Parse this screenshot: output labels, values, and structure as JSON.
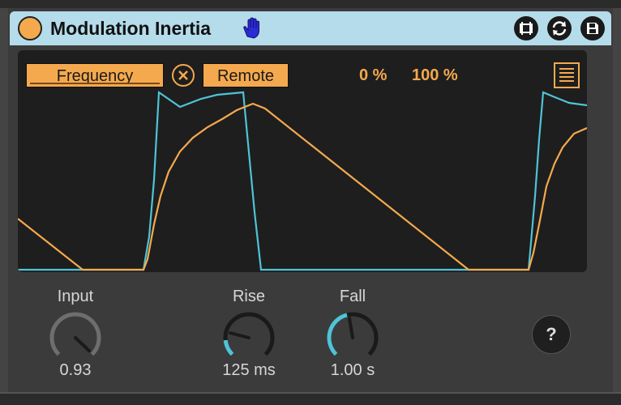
{
  "device": {
    "title": "Modulation Inertia",
    "accent_color": "#f5a94e",
    "title_bar_color": "#b5dcea",
    "trace_color_input": "#4fc3d8",
    "trace_color_output": "#f5a94e"
  },
  "header_icons": [
    "hand-icon",
    "resize-icon",
    "hot-swap-icon",
    "save-icon"
  ],
  "scope": {
    "target_label": "Frequency",
    "remote_label": "Remote",
    "range_min": "0 %",
    "range_max": "100 %"
  },
  "controls": {
    "input": {
      "label": "Input",
      "value": "0.93",
      "level": 0.93
    },
    "rise": {
      "label": "Rise",
      "value": "125 ms",
      "level": 0.2
    },
    "fall": {
      "label": "Fall",
      "value": "1.00 s",
      "level": 0.45
    }
  },
  "help": {
    "label": "?"
  }
}
